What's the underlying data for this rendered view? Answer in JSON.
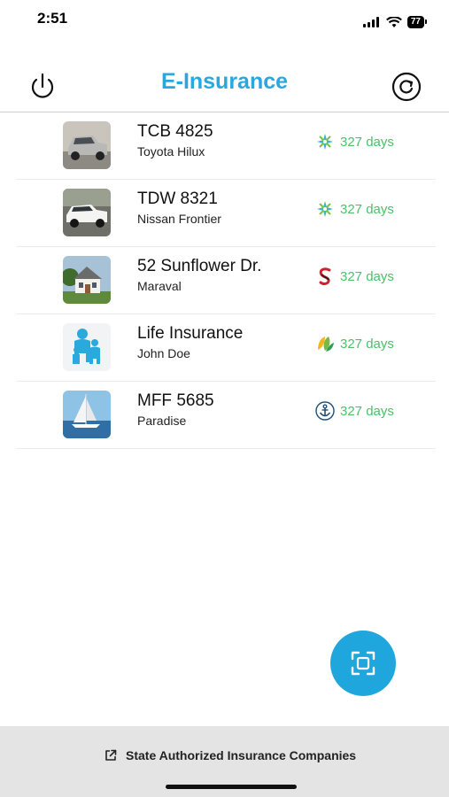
{
  "status_bar": {
    "time": "2:51",
    "battery": "77"
  },
  "header": {
    "title": "E-Insurance"
  },
  "policies": [
    {
      "title": "TCB 4825",
      "subtitle": "Toyota Hilux",
      "days": "327 days",
      "thumb": "pickup-truck-silver",
      "logo": "snowflake-star-logo"
    },
    {
      "title": "TDW 8321",
      "subtitle": "Nissan Frontier",
      "days": "327 days",
      "thumb": "pickup-truck-white",
      "logo": "snowflake-star-logo"
    },
    {
      "title": "52 Sunflower Dr.",
      "subtitle": "Maraval",
      "days": "327 days",
      "thumb": "house",
      "logo": "s-mark-logo"
    },
    {
      "title": "Life Insurance",
      "subtitle": "John Doe",
      "days": "327 days",
      "thumb": "family",
      "logo": "leaf-logo"
    },
    {
      "title": "MFF 5685",
      "subtitle": "Paradise",
      "days": "327 days",
      "thumb": "sailboat",
      "logo": "anchor-logo"
    }
  ],
  "footer": {
    "link_label": "State Authorized Insurance Companies"
  },
  "colors": {
    "accent": "#2aa7dc",
    "fab": "#1fa6dd",
    "days": "#4cc06a",
    "footer_bg": "#e4e4e4"
  }
}
